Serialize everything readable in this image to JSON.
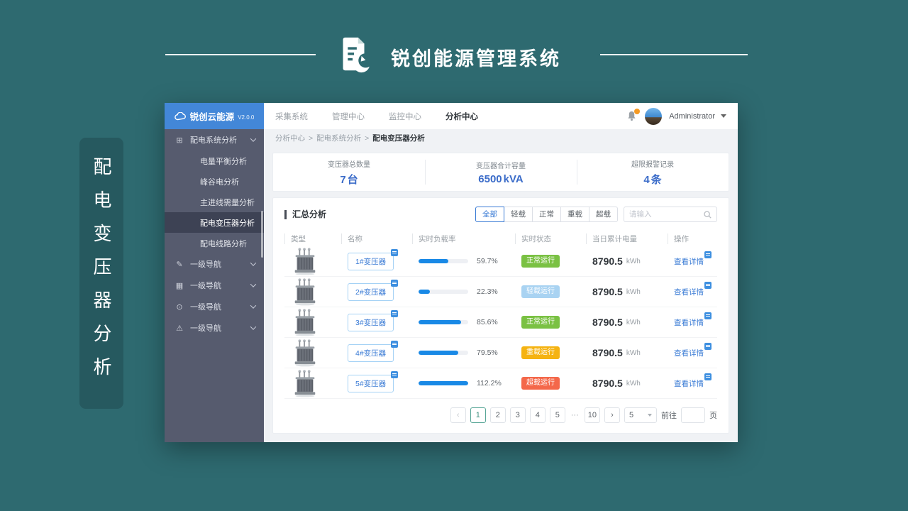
{
  "page": {
    "brand_title": "锐创能源管理系统",
    "side_label": "配电变压器分析",
    "background_color": "#2e6a70"
  },
  "icons": {
    "group": "⊞",
    "edit": "✎",
    "grid": "▦",
    "circle": "⊙",
    "warning": "⚠"
  },
  "app": {
    "logo": {
      "name": "锐创云能源",
      "version": "V2.0.0"
    },
    "sidebar": {
      "parent_label": "配电系统分析",
      "children": [
        "电量平衡分析",
        "峰谷电分析",
        "主进线需量分析",
        "配电变压器分析",
        "配电线路分析"
      ],
      "active_child": "配电变压器分析",
      "level1": [
        "一级导航",
        "一级导航",
        "一级导航",
        "一级导航"
      ]
    },
    "topnav": {
      "items": [
        "采集系统",
        "管理中心",
        "监控中心",
        "分析中心"
      ],
      "active": "分析中心",
      "user": "Administrator"
    },
    "breadcrumb": {
      "parts": [
        "分析中心",
        "配电系统分析",
        "配电变压器分析"
      ],
      "separator": ">"
    },
    "stats": [
      {
        "label": "变压器总数量",
        "value": "7",
        "unit": "台"
      },
      {
        "label": "变压器合计容量",
        "value": "6500",
        "unit": "kVA"
      },
      {
        "label": "超限报警记录",
        "value": "4",
        "unit": "条"
      }
    ],
    "panel": {
      "title": "汇总分析",
      "filters": [
        "全部",
        "轻载",
        "正常",
        "重载",
        "超载"
      ],
      "active_filter": "全部",
      "search_placeholder": "请输入"
    },
    "table": {
      "headers": [
        "类型",
        "名称",
        "实时负载率",
        "实时状态",
        "当日累计电量",
        "操作"
      ],
      "action_label": "查看详情",
      "energy_unit": "kWh",
      "rows": [
        {
          "name": "1#变压器",
          "load_pct": 59.7,
          "load_text": "59.7%",
          "status": "正常运行",
          "status_type": "normal",
          "energy": "8790.5"
        },
        {
          "name": "2#变压器",
          "load_pct": 22.3,
          "load_text": "22.3%",
          "status": "轻载运行",
          "status_type": "light",
          "energy": "8790.5"
        },
        {
          "name": "3#变压器",
          "load_pct": 85.6,
          "load_text": "85.6%",
          "status": "正常运行",
          "status_type": "normal",
          "energy": "8790.5"
        },
        {
          "name": "4#变压器",
          "load_pct": 79.5,
          "load_text": "79.5%",
          "status": "重载运行",
          "status_type": "heavy",
          "energy": "8790.5"
        },
        {
          "name": "5#变压器",
          "load_pct": 112.2,
          "load_text": "112.2%",
          "status": "超载运行",
          "status_type": "over",
          "energy": "8790.5"
        }
      ]
    },
    "pagination": {
      "prev": "‹",
      "next": "›",
      "pages": [
        "1",
        "2",
        "3",
        "4",
        "5",
        "···",
        "10"
      ],
      "active_page": "1",
      "size_value": "5",
      "goto_label": "前往",
      "unit_label": "页"
    }
  },
  "colors": {
    "accent_blue": "#3a7bd5",
    "progress_blue": "#1989e6",
    "status_normal": "#7ac143",
    "status_light": "#a9d3f2",
    "status_heavy": "#f5b312",
    "status_over": "#f4684a",
    "sidebar": "#565b6e",
    "sidebar_active": "#3d4254",
    "logo_blue": "#4387d8",
    "teal_background": "#2e6a70"
  }
}
